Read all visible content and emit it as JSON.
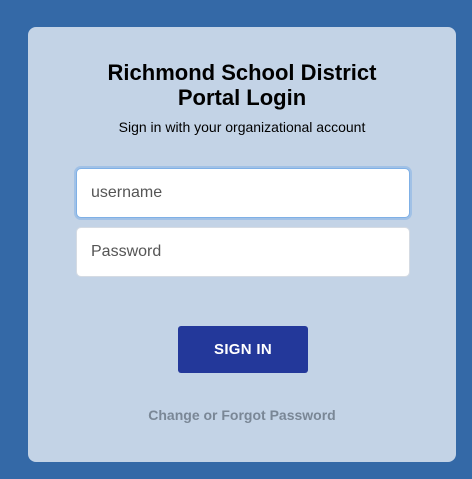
{
  "login": {
    "title_line1": "Richmond School District",
    "title_line2": "Portal Login",
    "subtitle": "Sign in with your organizational account",
    "username_placeholder": "username",
    "username_value": "",
    "password_placeholder": "Password",
    "password_value": "",
    "signin_label": "SIGN IN",
    "forgot_label": "Change or Forgot Password"
  },
  "colors": {
    "background": "#3469a7",
    "card": "#c3d3e6",
    "signin_button": "#23389a",
    "link": "#7a8796"
  }
}
